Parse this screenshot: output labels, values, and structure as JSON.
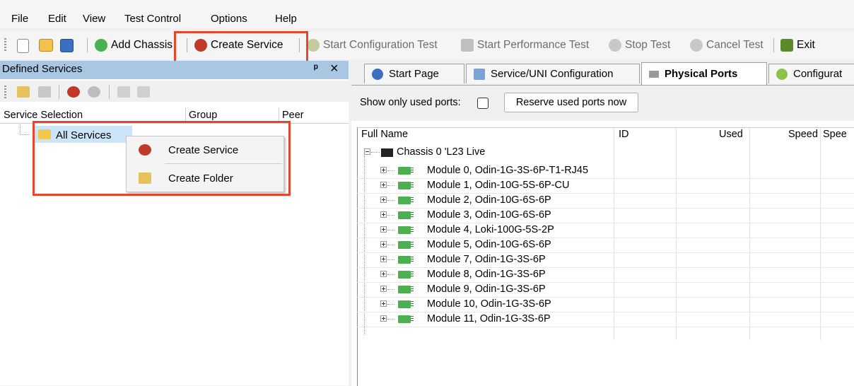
{
  "menubar": {
    "items": [
      "File",
      "Edit",
      "View",
      "Test Control",
      "Options",
      "Help"
    ]
  },
  "toolbar": {
    "add_chassis": "Add Chassis",
    "create_service": "Create Service",
    "start_config_test": "Start Configuration Test",
    "start_perf_test": "Start Performance Test",
    "stop_test": "Stop Test",
    "cancel_test": "Cancel Test",
    "exit": "Exit"
  },
  "left_panel": {
    "title": "Defined Services",
    "pin_glyph": "p",
    "close_glyph": "×",
    "columns": [
      "Service Selection",
      "Group",
      "Peer"
    ],
    "tree_root": "All Services",
    "context_menu": [
      "Create Service",
      "Create Folder"
    ]
  },
  "tabs": [
    "Start Page",
    "Service/UNI Configuration",
    "Physical Ports",
    "Configurat"
  ],
  "ports": {
    "show_only_used_label": "Show only used ports:",
    "reserve_button": "Reserve used ports now",
    "columns": [
      "Full Name",
      "ID",
      "Used",
      "Speed",
      "Spee"
    ],
    "chassis": "Chassis 0 'L23 Live",
    "modules": [
      "Module 0, Odin-1G-3S-6P-T1-RJ45",
      "Module 1, Odin-10G-5S-6P-CU",
      "Module 2, Odin-10G-6S-6P",
      "Module 3, Odin-10G-6S-6P",
      "Module 4, Loki-100G-5S-2P",
      "Module 5, Odin-10G-6S-6P",
      "Module 7, Odin-1G-3S-6P",
      "Module 8, Odin-1G-3S-6P",
      "Module 9, Odin-1G-3S-6P",
      "Module 10, Odin-1G-3S-6P",
      "Module 11, Odin-1G-3S-6P"
    ]
  },
  "colors": {
    "panel_header": "#a9c6e2",
    "highlight_box": "#e3472e",
    "module_icon": "#4caf50"
  }
}
